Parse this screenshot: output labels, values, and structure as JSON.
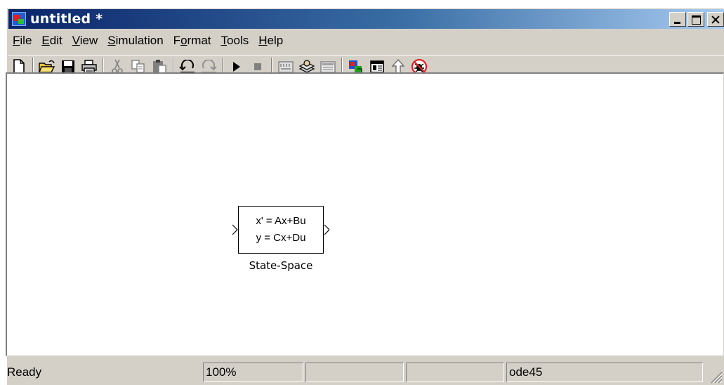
{
  "window": {
    "title": "untitled *",
    "app_icon": "simulink-model-icon"
  },
  "menubar": {
    "items": [
      {
        "label": "File",
        "mnemonic": "F",
        "rest": "ile"
      },
      {
        "label": "Edit",
        "mnemonic": "E",
        "rest": "dit"
      },
      {
        "label": "View",
        "mnemonic": "V",
        "rest": "iew"
      },
      {
        "label": "Simulation",
        "mnemonic": "S",
        "rest": "imulation"
      },
      {
        "label": "Format",
        "prefix": "F",
        "mnemonic": "o",
        "rest": "rmat"
      },
      {
        "label": "Tools",
        "mnemonic": "T",
        "rest": "ools"
      },
      {
        "label": "Help",
        "mnemonic": "H",
        "rest": "elp"
      }
    ]
  },
  "toolbar": {
    "icons": [
      "new-icon",
      "open-icon",
      "save-icon",
      "print-icon",
      "cut-icon",
      "copy-icon",
      "paste-icon",
      "undo-icon",
      "redo-icon",
      "start-icon",
      "stop-icon",
      "build-icon",
      "update-icon",
      "build-subsystem-icon",
      "library-browser-icon",
      "model-explorer-icon",
      "go-to-parent-icon",
      "debug-icon"
    ]
  },
  "block": {
    "line1": "x' = Ax+Bu",
    "line2": "y = Cx+Du",
    "label": "State-Space"
  },
  "statusbar": {
    "status": "Ready",
    "zoom": "100%",
    "panel3": "",
    "panel4": "",
    "solver": "ode45"
  }
}
